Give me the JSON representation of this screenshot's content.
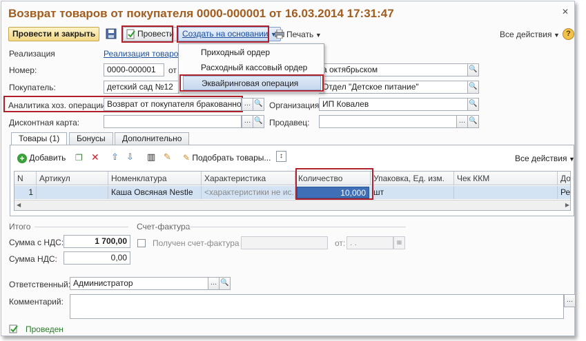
{
  "title": "Возврат товаров от покупателя 0000-000001 от 16.03.2014 17:31:47",
  "toolbar": {
    "post_close": "Провести и закрыть",
    "post": "Провести",
    "create_based": "Создать на основании",
    "print": "Печать",
    "all_actions": "Все действия",
    "help": "?"
  },
  "dropdown": {
    "items": [
      "Приходный ордер",
      "Расходный кассовый ордер",
      "Эквайринговая операция"
    ]
  },
  "form": {
    "realization_label": "Реализация",
    "realization_link": "Реализация товаров",
    "number_label": "Номер:",
    "number_value": "0000-000001",
    "from_label": "от",
    "warehouse_value": "а октябрьском",
    "buyer_label": "Покупатель:",
    "buyer_value": "детский сад №12",
    "contract_value": "Отдел \"Детское питание\"",
    "analytics_label": "Аналитика хоз. операции:",
    "analytics_value": "Возврат от покупателя бракованного т",
    "org_label": "Организация:",
    "org_value": "ИП Ковалев",
    "card_label": "Дисконтная карта:",
    "card_value": "",
    "seller_label": "Продавец:",
    "seller_value": ""
  },
  "tabs": [
    "Товары (1)",
    "Бонусы",
    "Дополнительно"
  ],
  "tab_toolbar": {
    "add": "Добавить",
    "pick": "Подобрать товары...",
    "all_actions": "Все действия"
  },
  "table": {
    "headers": [
      "N",
      "Артикул",
      "Номенклатура",
      "Характеристика",
      "Количество",
      "Упаковка, Ед. изм.",
      "Чек ККМ",
      "До"
    ],
    "row": [
      "1",
      "",
      "Каша Овсяная Nestle",
      "<характеристики не ис...",
      "10,000",
      "шт",
      "",
      "Ре"
    ]
  },
  "totals": {
    "section": "Итого",
    "sum_vat_label": "Сумма с НДС:",
    "sum_vat_value": "1 700,00",
    "vat_label": "Сумма НДС:",
    "vat_value": "0,00"
  },
  "invoice": {
    "section": "Счет-фактура",
    "received_label": "Получен счет-фактура N:",
    "number_value": "",
    "from_label": "от:",
    "date_value": " .  ."
  },
  "responsible": {
    "label": "Ответственный:",
    "value": "Администратор"
  },
  "comment": {
    "label": "Комментарий:",
    "value": ""
  },
  "status": "Проведен",
  "colors": {
    "title": "#a25d1e",
    "accent_red": "#b0202a",
    "link": "#1b4f9c"
  }
}
